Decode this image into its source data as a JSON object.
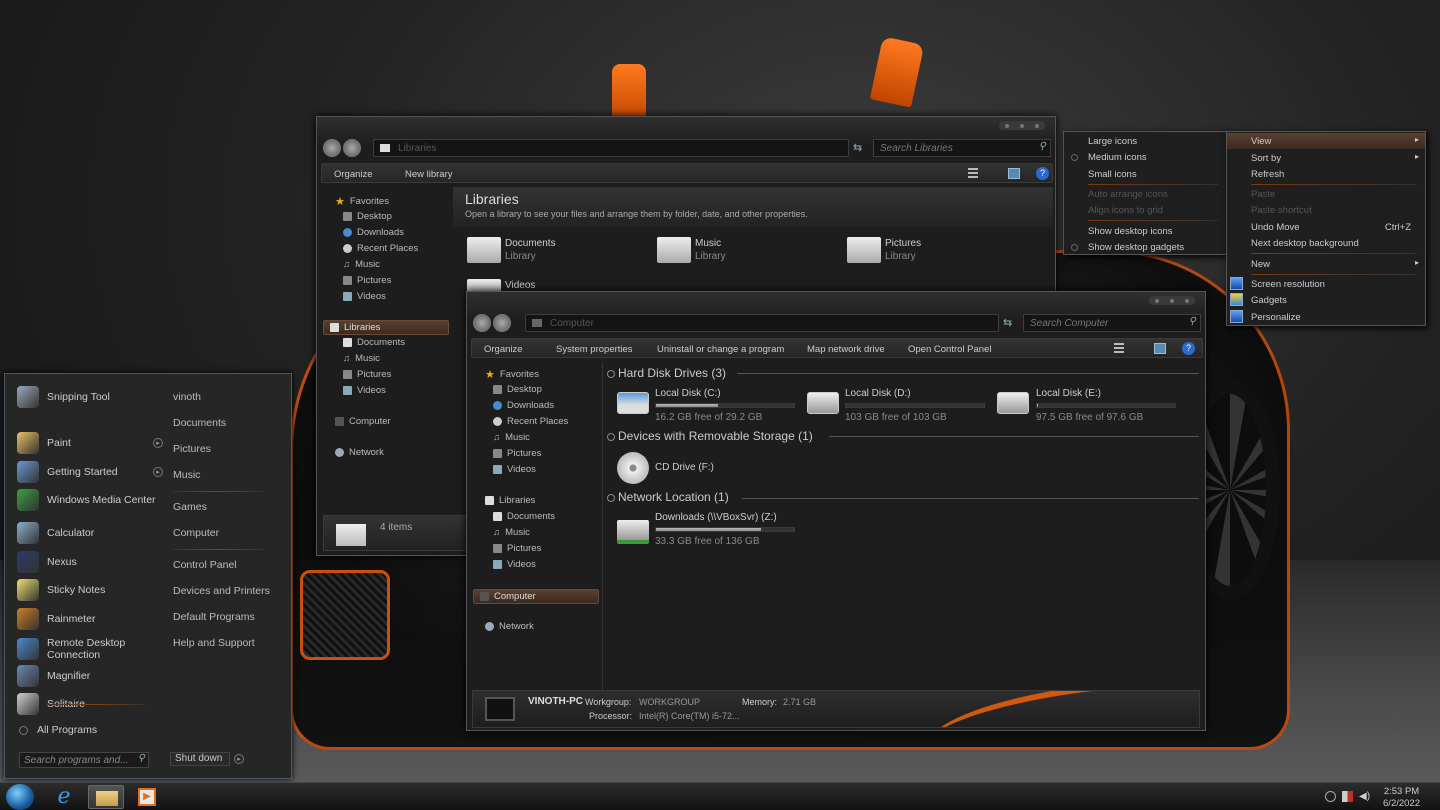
{
  "libraries_window": {
    "address": "Libraries",
    "search_placeholder": "Search Libraries",
    "toolbar": {
      "organize": "Organize",
      "new_library": "New library"
    },
    "nav": {
      "favorites": "Favorites",
      "fav_items": [
        "Desktop",
        "Downloads",
        "Recent Places",
        "Music",
        "Pictures",
        "Videos"
      ],
      "libraries": "Libraries",
      "lib_items": [
        "Documents",
        "Music",
        "Pictures",
        "Videos"
      ],
      "computer": "Computer",
      "network": "Network"
    },
    "header_title": "Libraries",
    "header_subtitle": "Open a library to see your files and arrange them by folder, date, and other properties.",
    "libraries": [
      {
        "name": "Documents",
        "type": "Library"
      },
      {
        "name": "Music",
        "type": "Library"
      },
      {
        "name": "Pictures",
        "type": "Library"
      },
      {
        "name": "Videos",
        "type": ""
      }
    ],
    "status": "4 items"
  },
  "computer_window": {
    "address": "Computer",
    "search_placeholder": "Search Computer",
    "toolbar": {
      "organize": "Organize",
      "system_properties": "System properties",
      "uninstall": "Uninstall or change a program",
      "map_network": "Map network drive",
      "open_control_panel": "Open Control Panel"
    },
    "nav": {
      "favorites": "Favorites",
      "fav_items": [
        "Desktop",
        "Downloads",
        "Recent Places",
        "Music",
        "Pictures",
        "Videos"
      ],
      "libraries": "Libraries",
      "lib_items": [
        "Documents",
        "Music",
        "Pictures",
        "Videos"
      ],
      "computer": "Computer",
      "network": "Network"
    },
    "groups": {
      "hard_disk": "Hard Disk Drives (3)",
      "removable": "Devices with Removable Storage (1)",
      "network": "Network Location (1)"
    },
    "drives": [
      {
        "name": "Local Disk (C:)",
        "free": "16.2 GB free of 29.2 GB",
        "used_fraction": 0.45
      },
      {
        "name": "Local Disk (D:)",
        "free": "103 GB free of 103 GB",
        "used_fraction": 0.0
      },
      {
        "name": "Local Disk (E:)",
        "free": "97.5 GB free of 97.6 GB",
        "used_fraction": 0.01
      }
    ],
    "cd_drive": "CD Drive (F:)",
    "network_drive": {
      "name": "Downloads (\\\\VBoxSvr) (Z:)",
      "free": "33.3 GB free of 136 GB",
      "used_fraction": 0.76
    },
    "details": {
      "pc_name": "VINOTH-PC",
      "workgroup_label": "Workgroup:",
      "workgroup": "WORKGROUP",
      "memory_label": "Memory:",
      "memory": "2.71 GB",
      "processor_label": "Processor:",
      "processor": "Intel(R) Core(TM) i5-72..."
    }
  },
  "view_submenu": {
    "items": [
      "Large icons",
      "Medium icons",
      "Small icons",
      "Auto arrange icons",
      "Align icons to grid",
      "Show desktop icons",
      "Show desktop gadgets"
    ]
  },
  "context_menu": {
    "view": "View",
    "sort_by": "Sort by",
    "refresh": "Refresh",
    "paste": "Paste",
    "paste_shortcut": "Paste shortcut",
    "undo_move": "Undo Move",
    "undo_shortcut": "Ctrl+Z",
    "next_bg": "Next desktop background",
    "new": "New",
    "screen_resolution": "Screen resolution",
    "gadgets": "Gadgets",
    "personalize": "Personalize"
  },
  "start_menu": {
    "programs": [
      {
        "label": "Snipping Tool",
        "icon": "scissors-icon",
        "color": "#9ab"
      },
      {
        "label": "Paint",
        "icon": "paint-icon",
        "color": "#e8c060"
      },
      {
        "label": "Getting Started",
        "icon": "getting-started-icon",
        "color": "#6a9ad0"
      },
      {
        "label": "Windows Media Center",
        "icon": "media-center-icon",
        "color": "#3aa040"
      },
      {
        "label": "Calculator",
        "icon": "calculator-icon",
        "color": "#8ab0d0"
      },
      {
        "label": "Nexus",
        "icon": "nexus-icon",
        "color": "#2a3a6a"
      },
      {
        "label": "Sticky Notes",
        "icon": "sticky-notes-icon",
        "color": "#f0e070"
      },
      {
        "label": "Rainmeter",
        "icon": "rainmeter-icon",
        "color": "#d08020"
      },
      {
        "label": "Remote Desktop Connection",
        "icon": "remote-desktop-icon",
        "color": "#4a8ad0"
      },
      {
        "label": "Magnifier",
        "icon": "magnifier-icon",
        "color": "#6a8ab0"
      },
      {
        "label": "Solitaire",
        "icon": "solitaire-icon",
        "color": "#d0d0d0"
      }
    ],
    "all_programs": "All Programs",
    "search_placeholder": "Search programs and...",
    "shutdown": "Shut down",
    "right": [
      "vinoth",
      "Documents",
      "Pictures",
      "Music",
      "Games",
      "Computer",
      "Control Panel",
      "Devices and Printers",
      "Default Programs",
      "Help and Support"
    ]
  },
  "taskbar": {
    "time": "2:53 PM",
    "date": "6/2/2022"
  }
}
